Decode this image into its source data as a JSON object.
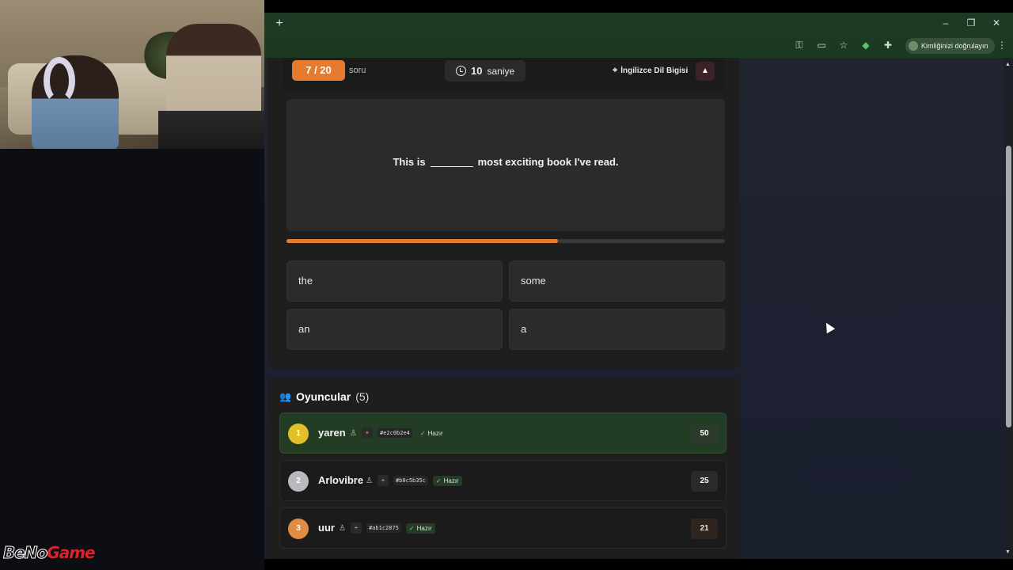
{
  "browser": {
    "new_tab_label": "+",
    "window_controls": [
      "–",
      "❐",
      "✕"
    ],
    "toolbar_icons": [
      "key-icon",
      "cast-icon",
      "star-icon",
      "shield-icon",
      "extensions-icon"
    ],
    "verify_label": "Kimliğinizi doğrulayın",
    "menu_icon": "⋮"
  },
  "quiz": {
    "counter": "7 / 20",
    "counter_label": "soru",
    "timer_value": "10",
    "timer_unit": "saniye",
    "category": "İngilizce Dil Bigisi",
    "report_icon": "▲",
    "question_before": "This is",
    "question_after": "most exciting book I've read.",
    "progress": 0.62,
    "options": [
      "the",
      "some",
      "an",
      "a"
    ]
  },
  "players": {
    "title": "Oyuncular",
    "count": "(5)",
    "list": [
      {
        "rank": "1",
        "name": "yaren",
        "id": "#e2c0b2e4",
        "status": "Hazır",
        "score": "50",
        "rank_color": "#e3c02a"
      },
      {
        "rank": "2",
        "name": "Arlovibre",
        "id": "#b0c5b35c",
        "status": "Hazır",
        "score": "25",
        "rank_color": "#b8b9be"
      },
      {
        "rank": "3",
        "name": "uur",
        "id": "#ab1c2875",
        "status": "Hazır",
        "score": "21",
        "rank_color": "#e08c45"
      }
    ]
  },
  "watermark": {
    "part1": "BeNo",
    "part2": "Game"
  },
  "colors": {
    "accent": "#e67a2e",
    "leader_row": "#233d24",
    "browser_frame": "#1f3a24"
  }
}
